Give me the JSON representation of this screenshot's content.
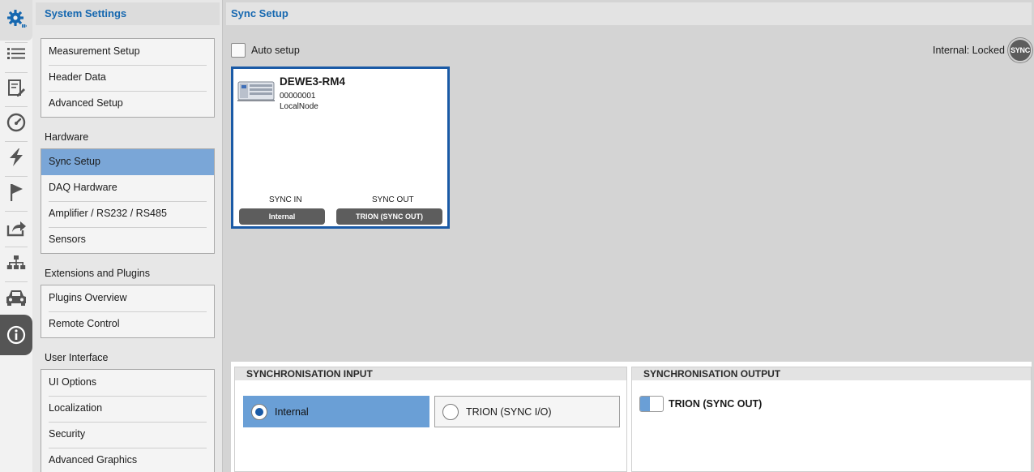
{
  "nav": {
    "title": "System Settings",
    "groups": {
      "general": [
        "Measurement Setup",
        "Header Data",
        "Advanced Setup"
      ],
      "hardware": [
        "Sync Setup",
        "DAQ Hardware",
        "Amplifier / RS232 / RS485",
        "Sensors"
      ],
      "extensions": [
        "Plugins Overview",
        "Remote Control"
      ],
      "ui": [
        "UI Options",
        "Localization",
        "Security",
        "Advanced Graphics"
      ]
    },
    "sections": {
      "hardware": "Hardware",
      "extensions": "Extensions and Plugins",
      "ui": "User Interface"
    },
    "active_item": "Sync Setup"
  },
  "rail": {
    "icons": [
      "gear-icon",
      "list-icon",
      "edit-document-icon",
      "gauge-icon",
      "lightning-icon",
      "flag-icon",
      "share-icon",
      "network-icon",
      "car-icon",
      "info-icon"
    ],
    "active": "gear-icon"
  },
  "content": {
    "title": "Sync Setup",
    "auto_setup": {
      "label": "Auto setup",
      "checked": false
    },
    "status": {
      "text": "Internal: Locked",
      "badge": "SYNC"
    }
  },
  "device": {
    "name": "DEWE3-RM4",
    "serial": "00000001",
    "node": "LocalNode",
    "sync_in": {
      "label": "SYNC IN",
      "value": "Internal"
    },
    "sync_out": {
      "label": "SYNC OUT",
      "value": "TRION (SYNC OUT)"
    }
  },
  "sync_input": {
    "title": "SYNCHRONISATION INPUT",
    "options": [
      "Internal",
      "TRION (SYNC I/O)"
    ],
    "selected": "Internal"
  },
  "sync_output": {
    "title": "SYNCHRONISATION OUTPUT",
    "option": "TRION (SYNC OUT)",
    "enabled": true
  },
  "colors": {
    "accent": "#1668b0",
    "selected": "#7aa6d7",
    "card_border": "#1a5aa6",
    "pill": "#5d5d5d"
  }
}
